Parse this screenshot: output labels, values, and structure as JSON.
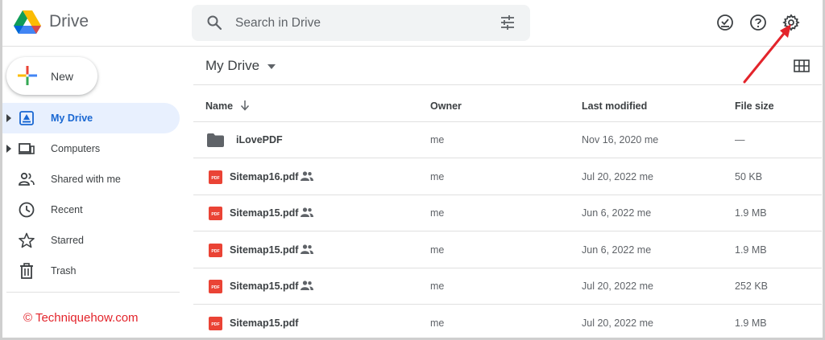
{
  "app": {
    "name": "Drive"
  },
  "search": {
    "placeholder": "Search in Drive"
  },
  "sidebar": {
    "new_label": "New",
    "items": [
      {
        "label": "My Drive"
      },
      {
        "label": "Computers"
      },
      {
        "label": "Shared with me"
      },
      {
        "label": "Recent"
      },
      {
        "label": "Starred"
      },
      {
        "label": "Trash"
      }
    ]
  },
  "watermark": "© Techniquehow.com",
  "main": {
    "title": "My Drive",
    "columns": {
      "name": "Name",
      "owner": "Owner",
      "modified": "Last modified",
      "size": "File size"
    },
    "files": [
      {
        "name": "iLovePDF",
        "type": "folder",
        "shared": false,
        "owner": "me",
        "modified": "Nov 16, 2020  me",
        "size": "—"
      },
      {
        "name": "Sitemap16.pdf",
        "type": "pdf",
        "shared": true,
        "owner": "me",
        "modified": "Jul 20, 2022  me",
        "size": "50 KB"
      },
      {
        "name": "Sitemap15.pdf",
        "type": "pdf",
        "shared": true,
        "owner": "me",
        "modified": "Jun 6, 2022  me",
        "size": "1.9 MB"
      },
      {
        "name": "Sitemap15.pdf",
        "type": "pdf",
        "shared": true,
        "owner": "me",
        "modified": "Jun 6, 2022  me",
        "size": "1.9 MB"
      },
      {
        "name": "Sitemap15.pdf",
        "type": "pdf",
        "shared": true,
        "owner": "me",
        "modified": "Jul 20, 2022  me",
        "size": "252 KB"
      },
      {
        "name": "Sitemap15.pdf",
        "type": "pdf",
        "shared": false,
        "owner": "me",
        "modified": "Jul 20, 2022  me",
        "size": "1.9 MB"
      }
    ]
  },
  "icons": {
    "pdf_label": "PDF"
  },
  "colors": {
    "accent": "#1967d2",
    "active_bg": "#e8f0fe",
    "pdf_red": "#ea4335",
    "annotation_red": "#e3242b"
  }
}
